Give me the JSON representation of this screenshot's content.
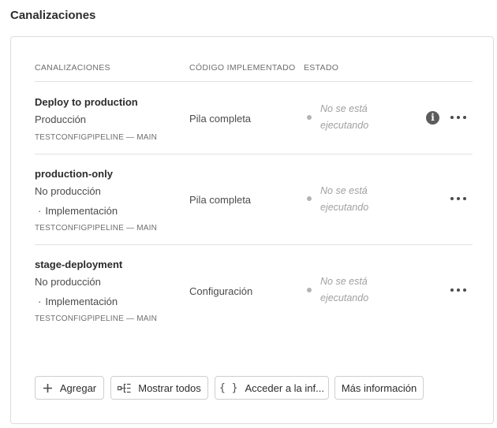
{
  "section": {
    "title": "Canalizaciones"
  },
  "table": {
    "headers": {
      "pipelines": "CANALIZACIONES",
      "code": "CÓDIGO IMPLEMENTADO",
      "status": "ESTADO"
    },
    "rows": [
      {
        "name": "Deploy to production",
        "env": "Producción",
        "sub": "",
        "repo": "TESTCONFIGPIPELINE — MAIN",
        "code": "Pila completa",
        "status_line1": "No se está",
        "status_line2": "ejecutando",
        "has_info": true
      },
      {
        "name": "production-only",
        "env": "No producción",
        "sub": "Implementación",
        "repo": "TESTCONFIGPIPELINE — MAIN",
        "code": "Pila completa",
        "status_line1": "No se está",
        "status_line2": "ejecutando",
        "has_info": false
      },
      {
        "name": "stage-deployment",
        "env": "No producción",
        "sub": "Implementación",
        "repo": "TESTCONFIGPIPELINE — MAIN",
        "code": "Configuración",
        "status_line1": "No se está",
        "status_line2": "ejecutando",
        "has_info": false
      }
    ],
    "bullet": "·",
    "info_glyph": "i"
  },
  "actions": {
    "add_label": "Agregar",
    "show_all_label": "Mostrar todos",
    "access_label": "Acceder a la inf...",
    "more_info_label": "Más información",
    "add_icon": "plus-icon",
    "show_all_icon": "pipeline-list-icon",
    "access_icon": "curly-braces-icon",
    "access_glyph": "{ }"
  },
  "colors": {
    "status_dot": "#b3b3b3",
    "status_text": "#a0a0a0",
    "info_icon": "#5c5c5c",
    "border": "#dcdcdc"
  }
}
